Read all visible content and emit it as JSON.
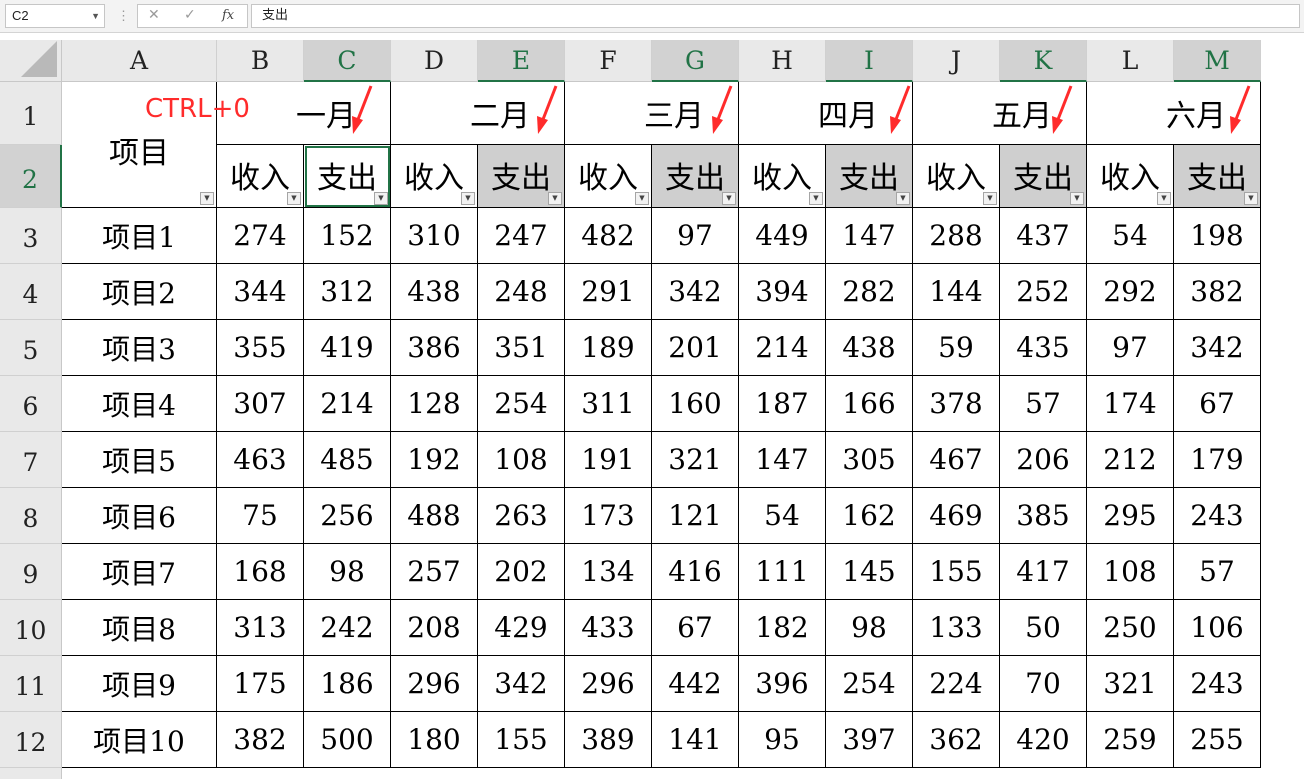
{
  "formula_bar": {
    "name_box": "C2",
    "cancel_icon": "close-icon",
    "confirm_icon": "check-icon",
    "function_icon": "fx-icon",
    "formula": "支出"
  },
  "columns": [
    "A",
    "B",
    "C",
    "D",
    "E",
    "F",
    "G",
    "H",
    "I",
    "J",
    "K",
    "L",
    "M"
  ],
  "rows": [
    "1",
    "2",
    "3",
    "4",
    "5",
    "6",
    "7",
    "8",
    "9",
    "10",
    "11",
    "12"
  ],
  "selected_cell": "C2",
  "header": {
    "project_label": "项目",
    "shortcut_annotation": "CTRL+0",
    "months": [
      "一月",
      "二月",
      "三月",
      "四月",
      "五月",
      "六月"
    ],
    "income_label": "收入",
    "expense_label": "支出"
  },
  "table": [
    {
      "name": "项目1",
      "values": [
        274,
        152,
        310,
        247,
        482,
        97,
        449,
        147,
        288,
        437,
        54,
        198
      ]
    },
    {
      "name": "项目2",
      "values": [
        344,
        312,
        438,
        248,
        291,
        342,
        394,
        282,
        144,
        252,
        292,
        382
      ]
    },
    {
      "name": "项目3",
      "values": [
        355,
        419,
        386,
        351,
        189,
        201,
        214,
        438,
        59,
        435,
        97,
        342
      ]
    },
    {
      "name": "项目4",
      "values": [
        307,
        214,
        128,
        254,
        311,
        160,
        187,
        166,
        378,
        57,
        174,
        67
      ]
    },
    {
      "name": "项目5",
      "values": [
        463,
        485,
        192,
        108,
        191,
        321,
        147,
        305,
        467,
        206,
        212,
        179
      ]
    },
    {
      "name": "项目6",
      "values": [
        75,
        256,
        488,
        263,
        173,
        121,
        54,
        162,
        469,
        385,
        295,
        243
      ]
    },
    {
      "name": "项目7",
      "values": [
        168,
        98,
        257,
        202,
        134,
        416,
        111,
        145,
        155,
        417,
        108,
        57
      ]
    },
    {
      "name": "项目8",
      "values": [
        313,
        242,
        208,
        429,
        433,
        67,
        182,
        98,
        133,
        50,
        250,
        106
      ]
    },
    {
      "name": "项目9",
      "values": [
        175,
        186,
        296,
        342,
        296,
        442,
        396,
        254,
        224,
        70,
        321,
        243
      ]
    },
    {
      "name": "项目10",
      "values": [
        382,
        500,
        180,
        155,
        389,
        141,
        95,
        397,
        362,
        420,
        259,
        255
      ]
    }
  ],
  "colors": {
    "annotation": "#ff2b2b",
    "hidden_column_fill": "#cfcfcf",
    "selection": "#217346"
  }
}
